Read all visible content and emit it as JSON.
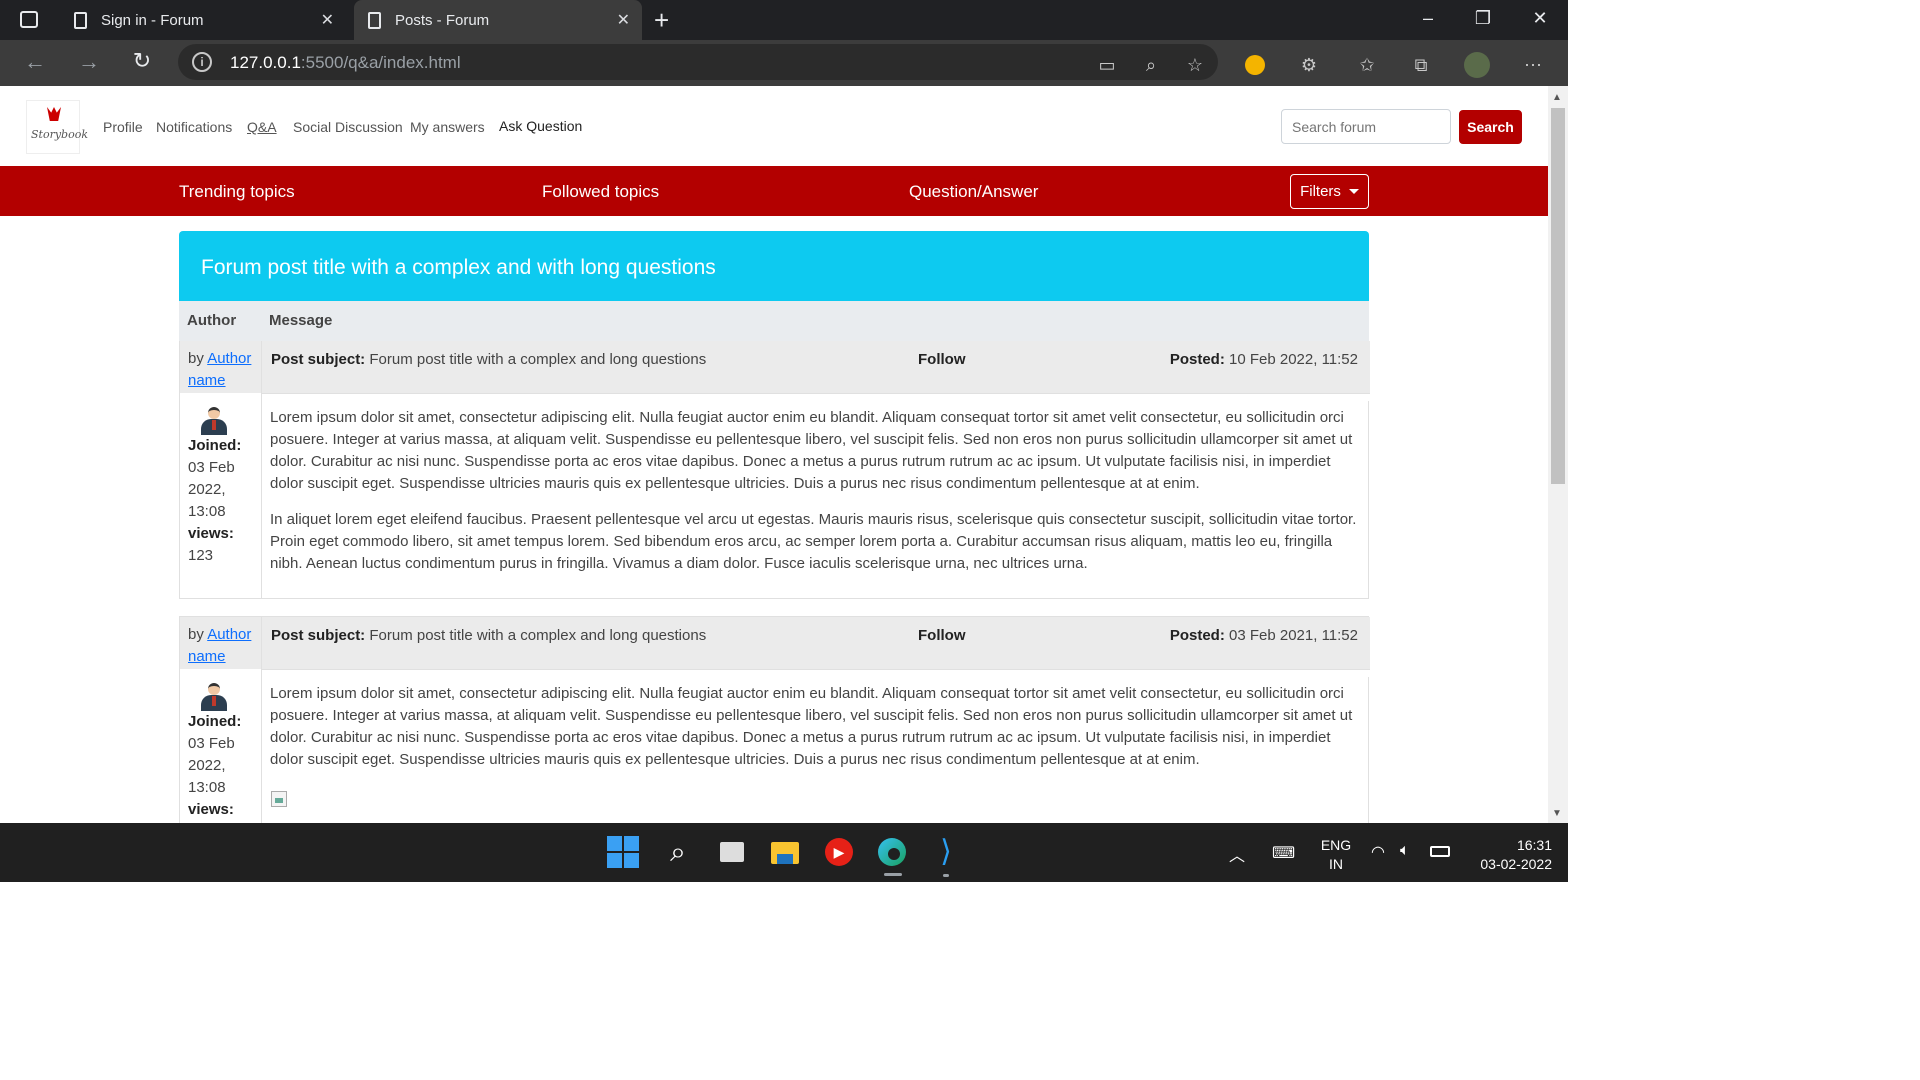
{
  "browser": {
    "tabs": [
      {
        "title": "Sign in - Forum",
        "active": false
      },
      {
        "title": "Posts - Forum",
        "active": true
      }
    ],
    "url_host": "127.0.0.1",
    "url_path": ":5500/q&a/index.html"
  },
  "site": {
    "logo_text": "Storybook",
    "nav": [
      "Profile",
      "Notifications",
      "Q&A",
      "Social Discussion",
      "My answers",
      "Ask Question"
    ],
    "search_placeholder": "Search forum",
    "search_button": "Search",
    "subnav": [
      "Trending topics",
      "Followed topics",
      "Question/Answer"
    ],
    "filters_label": "Filters",
    "accent_color": "#b30000",
    "banner_color": "#0dcaf0"
  },
  "thread": {
    "title": "Forum post title with a complex and with long questions",
    "col_author": "Author",
    "col_message": "Message",
    "posts": [
      {
        "by": "by",
        "author": "Author name",
        "subject_label": "Post subject:",
        "subject": "Forum post title with a complex and long questions",
        "follow": "Follow",
        "posted_label": "Posted:",
        "posted": "10 Feb 2022, 11:52",
        "joined_label": "Joined:",
        "joined": "03 Feb 2022, 13:08",
        "views_label": "views:",
        "views": "123",
        "paragraphs": [
          "Lorem ipsum dolor sit amet, consectetur adipiscing elit. Nulla feugiat auctor enim eu blandit. Aliquam consequat tortor sit amet velit consectetur, eu sollicitudin orci posuere. Integer at varius massa, at aliquam velit. Suspendisse eu pellentesque libero, vel suscipit felis. Sed non eros non purus sollicitudin ullamcorper sit amet ut dolor. Curabitur ac nisi nunc. Suspendisse porta ac eros vitae dapibus. Donec a metus a purus rutrum rutrum ac ac ipsum. Ut vulputate facilisis nisi, in imperdiet dolor suscipit eget. Suspendisse ultricies mauris quis ex pellentesque ultricies. Duis a purus nec risus condimentum pellentesque at at enim.",
          "In aliquet lorem eget eleifend faucibus. Praesent pellentesque vel arcu ut egestas. Mauris mauris risus, scelerisque quis consectetur suscipit, sollicitudin vitae tortor. Proin eget commodo libero, sit amet tempus lorem. Sed bibendum eros arcu, ac semper lorem porta a. Curabitur accumsan risus aliquam, mattis leo eu, fringilla nibh. Aenean luctus condimentum purus in fringilla. Vivamus a diam dolor. Fusce iaculis scelerisque urna, nec ultrices urna."
        ]
      },
      {
        "by": "by",
        "author": "Author name",
        "subject_label": "Post subject:",
        "subject": "Forum post title with a complex and long questions",
        "follow": "Follow",
        "posted_label": "Posted:",
        "posted": "03 Feb 2021, 11:52",
        "joined_label": "Joined:",
        "joined": "03 Feb 2022, 13:08",
        "views_label": "views:",
        "paragraphs": [
          "Lorem ipsum dolor sit amet, consectetur adipiscing elit. Nulla feugiat auctor enim eu blandit. Aliquam consequat tortor sit amet velit consectetur, eu sollicitudin orci posuere. Integer at varius massa, at aliquam velit. Suspendisse eu pellentesque libero, vel suscipit felis. Sed non eros non purus sollicitudin ullamcorper sit amet ut dolor. Curabitur ac nisi nunc. Suspendisse porta ac eros vitae dapibus. Donec a metus a purus rutrum rutrum ac ac ipsum. Ut vulputate facilisis nisi, in imperdiet dolor suscipit eget. Suspendisse ultricies mauris quis ex pellentesque ultricies. Duis a purus nec risus condimentum pellentesque at at enim."
        ]
      }
    ]
  },
  "taskbar": {
    "lang_top": "ENG",
    "lang_bottom": "IN",
    "time": "16:31",
    "date": "03-02-2022"
  }
}
